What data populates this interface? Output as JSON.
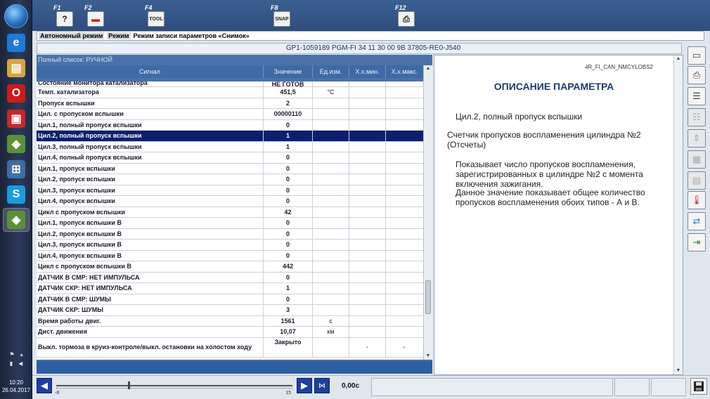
{
  "taskbar": {
    "items": [
      {
        "name": "start-orb",
        "active": false
      },
      {
        "name": "ie-icon",
        "glyph": "e",
        "color": "#1e78d6"
      },
      {
        "name": "explorer-icon",
        "glyph": "▤",
        "color": "#d9a441"
      },
      {
        "name": "opera-icon",
        "glyph": "O",
        "color": "#cc1b1b"
      },
      {
        "name": "app-red-icon",
        "glyph": "▣",
        "color": "#c62828"
      },
      {
        "name": "hds-icon",
        "glyph": "◈",
        "color": "#5b8f3a"
      },
      {
        "name": "network-tool-icon",
        "glyph": "⊞",
        "color": "#3e6d9f"
      },
      {
        "name": "skype-icon",
        "glyph": "S",
        "color": "#1a9be0"
      },
      {
        "name": "hds-active-icon",
        "glyph": "◈",
        "color": "#5b8f3a"
      }
    ],
    "clock_time": "10:20",
    "clock_date": "26.04.2017"
  },
  "toolbar": {
    "keys": [
      {
        "label": "F1",
        "icon": "?"
      },
      {
        "label": "F2",
        "icon": "🚗"
      },
      {
        "label": "F4",
        "icon": "TOOL"
      },
      {
        "label": "F8",
        "icon": "SNAP"
      },
      {
        "label": "F12",
        "icon": "⎙"
      }
    ]
  },
  "mode_bar": {
    "seg1": "Автономный режим",
    "seg2": "Режим",
    "seg3": "Режим записи параметров «Снимок»"
  },
  "ecu_bar": {
    "text": "GP1-1059189  PGM-FI  34 11 30 00 9B  37805-RE0-J540"
  },
  "list": {
    "title": "Полный список: РУЧНОЙ",
    "headers": {
      "signal": "Сигнал",
      "value": "Значение",
      "unit": "Ед.изм.",
      "min": "Х.х.мин.",
      "max": "Х.х.макс."
    },
    "rows": [
      {
        "signal": "Состояние монитора катализатора",
        "value": "НЕ ГОТОВ",
        "unit": "",
        "partial": true
      },
      {
        "signal": "Темп. катализатора",
        "value": "451,5",
        "unit": "°C"
      },
      {
        "signal": "Пропуск вспышки",
        "value": "2",
        "unit": ""
      },
      {
        "signal": "Цил. с пропуском вспышки",
        "value": "00000110",
        "unit": ""
      },
      {
        "signal": "Цил.1, полный пропуск вспышки",
        "value": "0",
        "unit": ""
      },
      {
        "signal": "Цил.2, полный пропуск вспышки",
        "value": "1",
        "unit": "",
        "selected": true
      },
      {
        "signal": "Цил.3, полный пропуск вспышки",
        "value": "1",
        "unit": ""
      },
      {
        "signal": "Цил.4, полный пропуск вспышки",
        "value": "0",
        "unit": ""
      },
      {
        "signal": "Цил.1, пропуск вспышки",
        "value": "0",
        "unit": ""
      },
      {
        "signal": "Цил.2, пропуск вспышки",
        "value": "0",
        "unit": ""
      },
      {
        "signal": "Цил.3, пропуск вспышки",
        "value": "0",
        "unit": ""
      },
      {
        "signal": "Цил.4, пропуск вспышки",
        "value": "0",
        "unit": ""
      },
      {
        "signal": "Цикл с пропуском вспышки",
        "value": "42",
        "unit": ""
      },
      {
        "signal": "Цил.1, пропуск вспышки B",
        "value": "0",
        "unit": ""
      },
      {
        "signal": "Цил.2, пропуск вспышки B",
        "value": "0",
        "unit": ""
      },
      {
        "signal": "Цил.3, пропуск вспышки B",
        "value": "0",
        "unit": ""
      },
      {
        "signal": "Цил.4, пропуск вспышки B",
        "value": "0",
        "unit": ""
      },
      {
        "signal": "Цикл с пропуском вспышки B",
        "value": "442",
        "unit": ""
      },
      {
        "signal": "ДАТЧИК В СМР: НЕТ ИМПУЛЬСА",
        "value": "0",
        "unit": ""
      },
      {
        "signal": "ДАТЧИК СКР: НЕТ ИМПУЛЬСА",
        "value": "1",
        "unit": ""
      },
      {
        "signal": "ДАТЧИК В СМР: ШУМЫ",
        "value": "0",
        "unit": ""
      },
      {
        "signal": "ДАТЧИК СКР: ШУМЫ",
        "value": "3",
        "unit": ""
      },
      {
        "signal": "Время работы двиг.",
        "value": "1561",
        "unit": "с"
      },
      {
        "signal": "Дист. движения",
        "value": "10,07",
        "unit": "км"
      },
      {
        "signal": "Выкл. тормоза в круиз-контроле/выкл. остановки на холостом ходу",
        "value": "Закрыто",
        "unit": "",
        "min": "-",
        "max": "-",
        "tall": true
      }
    ]
  },
  "description": {
    "code": "4R_FI_CAN_NMCYLOBS2",
    "title": "ОПИСАНИЕ ПАРАМЕТРА",
    "name": "Цил.2, полный пропуск вспышки",
    "counter": "Счетчик пропусков воспламенения цилиндра №2 (Отсчеты)",
    "text1": "Показывает число пропусков воспламенения, зарегистрированных в цилиндре №2 с момента включения зажигания.",
    "text2": "Данное значение показывает общее количество пропусков воспламенения обоих типов - А и В."
  },
  "bottom": {
    "slider_min": "-8",
    "slider_max": "15",
    "slider_value": -1,
    "time": "0,00с"
  }
}
